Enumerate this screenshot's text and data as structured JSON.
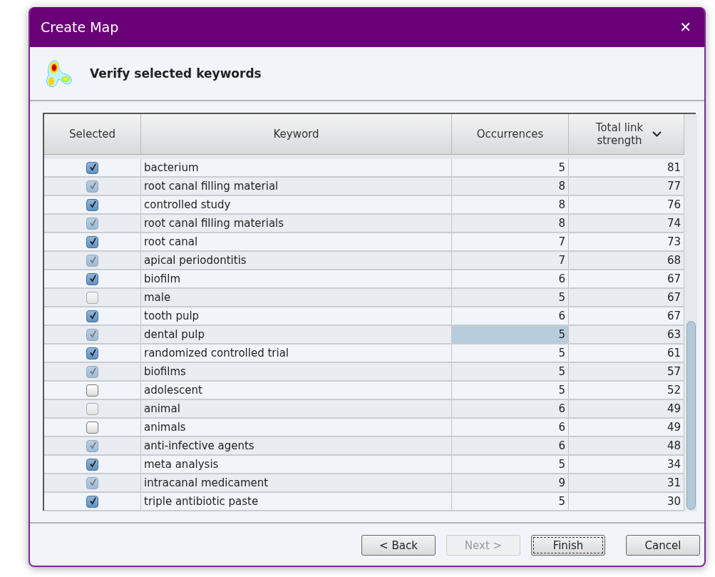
{
  "window": {
    "title": "Create Map",
    "close": "✕"
  },
  "header": {
    "title": "Verify selected keywords"
  },
  "table": {
    "columns": [
      {
        "label": "Selected"
      },
      {
        "label": "Keyword"
      },
      {
        "label": "Occurrences"
      },
      {
        "label": "Total link strength",
        "sorted": true
      }
    ],
    "rows": [
      {
        "checked": true,
        "keyword": "bacterium",
        "occurrences": "5",
        "strength": "81",
        "selected": false
      },
      {
        "checked": true,
        "keyword": "root canal filling material",
        "occurrences": "8",
        "strength": "77",
        "selected": false
      },
      {
        "checked": true,
        "keyword": "controlled study",
        "occurrences": "8",
        "strength": "76",
        "selected": false
      },
      {
        "checked": true,
        "keyword": "root canal filling materials",
        "occurrences": "8",
        "strength": "74",
        "selected": false
      },
      {
        "checked": true,
        "keyword": "root canal",
        "occurrences": "7",
        "strength": "73",
        "selected": false
      },
      {
        "checked": true,
        "keyword": "apical periodontitis",
        "occurrences": "7",
        "strength": "68",
        "selected": false
      },
      {
        "checked": true,
        "keyword": "biofilm",
        "occurrences": "6",
        "strength": "67",
        "selected": false
      },
      {
        "checked": false,
        "keyword": "male",
        "occurrences": "5",
        "strength": "67",
        "selected": false
      },
      {
        "checked": true,
        "keyword": "tooth pulp",
        "occurrences": "6",
        "strength": "67",
        "selected": false
      },
      {
        "checked": true,
        "keyword": "dental pulp",
        "occurrences": "5",
        "strength": "63",
        "selected": true
      },
      {
        "checked": true,
        "keyword": "randomized controlled trial",
        "occurrences": "5",
        "strength": "61",
        "selected": false
      },
      {
        "checked": true,
        "keyword": "biofilms",
        "occurrences": "5",
        "strength": "57",
        "selected": false
      },
      {
        "checked": false,
        "keyword": "adolescent",
        "occurrences": "5",
        "strength": "52",
        "selected": false
      },
      {
        "checked": false,
        "keyword": "animal",
        "occurrences": "6",
        "strength": "49",
        "selected": false
      },
      {
        "checked": false,
        "keyword": "animals",
        "occurrences": "6",
        "strength": "49",
        "selected": false
      },
      {
        "checked": true,
        "keyword": "anti-infective agents",
        "occurrences": "6",
        "strength": "48",
        "selected": false
      },
      {
        "checked": true,
        "keyword": "meta analysis",
        "occurrences": "5",
        "strength": "34",
        "selected": false
      },
      {
        "checked": true,
        "keyword": "intracanal medicament",
        "occurrences": "9",
        "strength": "31",
        "selected": false
      },
      {
        "checked": true,
        "keyword": "triple antibiotic paste",
        "occurrences": "5",
        "strength": "30",
        "selected": false
      }
    ]
  },
  "buttons": [
    {
      "label": "< Back",
      "disabled": false,
      "focused": false
    },
    {
      "label": "Next >",
      "disabled": true,
      "focused": false
    },
    {
      "label": "Finish",
      "disabled": false,
      "focused": true
    },
    {
      "label": "Cancel",
      "disabled": false,
      "focused": false
    }
  ]
}
